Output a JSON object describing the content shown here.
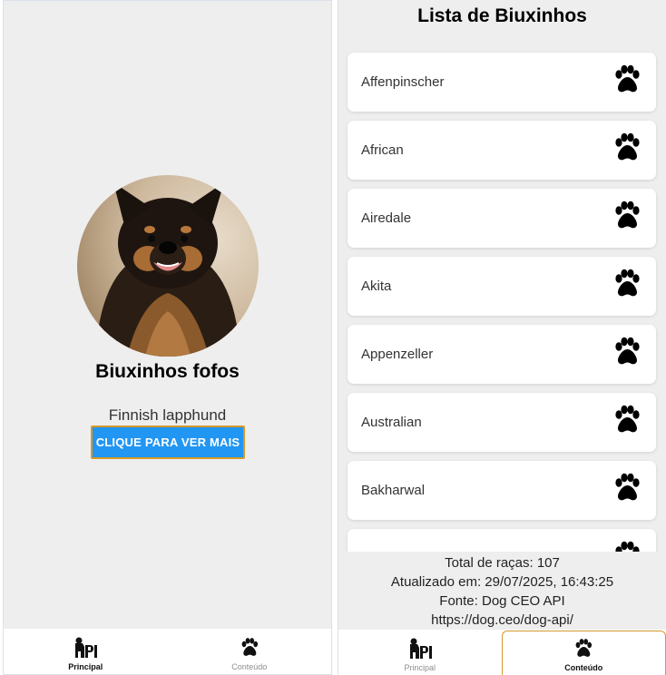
{
  "home": {
    "title": "Biuxinhos fofos",
    "breed": "Finnish lapphund",
    "button_label": "CLIQUE PARA VER MAIS",
    "image_alt": "dog-photo"
  },
  "list": {
    "title": "Lista de Biuxinhos",
    "items": [
      {
        "label": "Affenpinscher",
        "icon": "paw-icon"
      },
      {
        "label": "African",
        "icon": "paw-icon"
      },
      {
        "label": "Airedale",
        "icon": "paw-icon"
      },
      {
        "label": "Akita",
        "icon": "paw-icon"
      },
      {
        "label": "Appenzeller",
        "icon": "paw-icon"
      },
      {
        "label": "Australian",
        "icon": "paw-icon"
      },
      {
        "label": "Bakharwal",
        "icon": "paw-icon"
      },
      {
        "label": "",
        "icon": "paw-icon"
      }
    ],
    "footer": {
      "total": "Total de raças: 107",
      "updated": "Atualizado em: 29/07/2025, 16:43:25",
      "source": "Fonte: Dog CEO API",
      "url": "https://dog.ceo/dog-api/"
    }
  },
  "tabs": {
    "principal": "Principal",
    "conteudo": "Conteúdo"
  },
  "colors": {
    "button": "#2196f3",
    "focus_outline": "#d49a2a",
    "background": "#eeeeee"
  }
}
